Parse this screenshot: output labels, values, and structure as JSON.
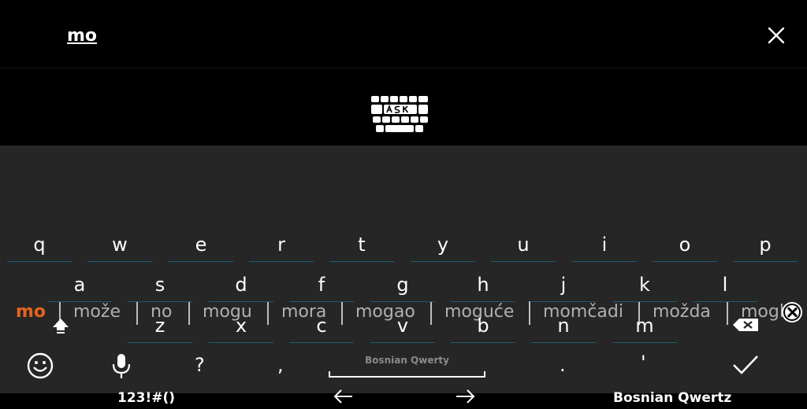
{
  "input": {
    "typed_text": "mo"
  },
  "suggestions": {
    "primary": "mo",
    "items": [
      "može",
      "no",
      "mogu",
      "mora",
      "mogao",
      "moguće",
      "momčadi",
      "možda",
      "mogl"
    ]
  },
  "control_row": {
    "symbols_label": "123!#()",
    "language_label": "Bosnian Qwertz"
  },
  "keys": {
    "row1": [
      "q",
      "w",
      "e",
      "r",
      "t",
      "y",
      "u",
      "i",
      "o",
      "p"
    ],
    "row2": [
      "a",
      "s",
      "d",
      "f",
      "g",
      "h",
      "j",
      "k",
      "l"
    ],
    "row3": [
      "z",
      "x",
      "c",
      "v",
      "b",
      "n",
      "m"
    ],
    "question": "?",
    "comma": ",",
    "period": ".",
    "apostrophe": "'",
    "space_label": "Bosnian Qwerty"
  },
  "colors": {
    "accent": "#e5641f",
    "keyboard_bg": "#262626",
    "top_bg": "#000000",
    "suggestion_text": "#b0b0b0",
    "key_underline": "#1f5a7a"
  },
  "icons": {
    "close": "close-icon",
    "logo": "ask-keyboard-logo",
    "left_arrow": "arrow-left-icon",
    "right_arrow": "arrow-right-icon",
    "shift": "shift-icon",
    "backspace": "backspace-icon",
    "emoji": "emoji-icon",
    "mic": "microphone-icon",
    "enter": "checkmark-icon",
    "suggestions_close": "close-circle-icon"
  }
}
